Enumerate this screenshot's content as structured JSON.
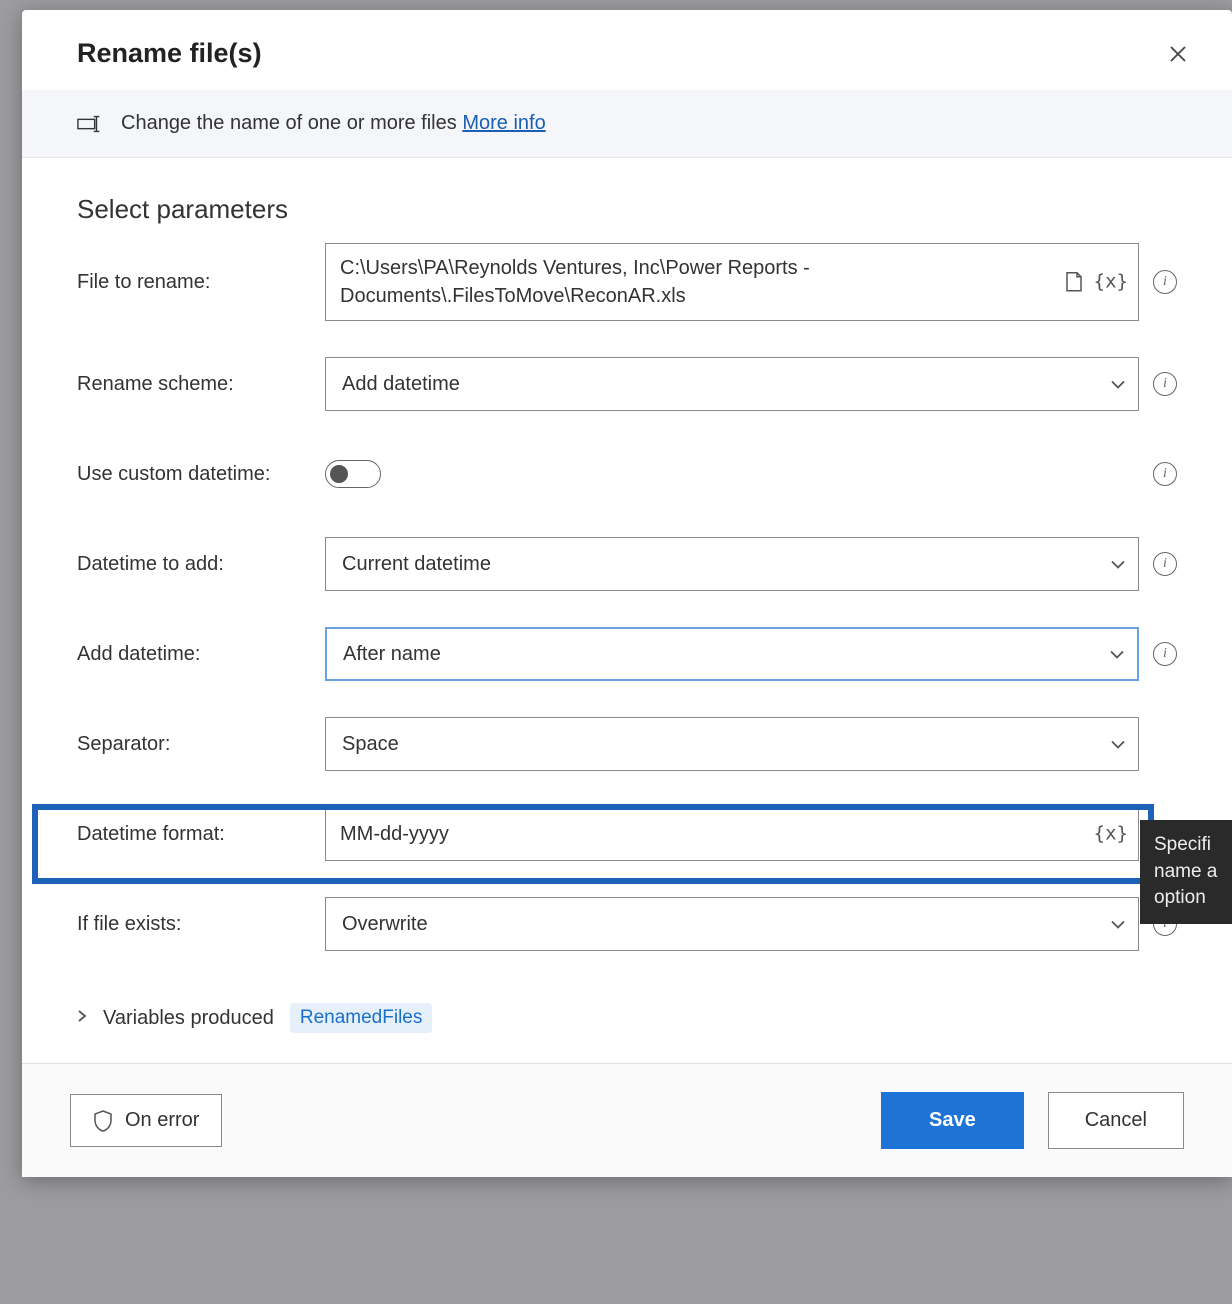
{
  "dialog": {
    "title": "Rename file(s)",
    "infoText": "Change the name of one or more files",
    "moreInfo": "More info",
    "sectionTitle": "Select parameters"
  },
  "fields": {
    "fileToRename": {
      "label": "File to rename:",
      "value": "C:\\Users\\PA\\Reynolds Ventures, Inc\\Power Reports - Documents\\.FilesToMove\\ReconAR.xls"
    },
    "renameScheme": {
      "label": "Rename scheme:",
      "value": "Add datetime"
    },
    "useCustomDatetime": {
      "label": "Use custom datetime:"
    },
    "datetimeToAdd": {
      "label": "Datetime to add:",
      "value": "Current datetime"
    },
    "addDatetime": {
      "label": "Add datetime:",
      "value": "After name"
    },
    "separator": {
      "label": "Separator:",
      "value": "Space"
    },
    "datetimeFormat": {
      "label": "Datetime format:",
      "value": "MM-dd-yyyy"
    },
    "ifFileExists": {
      "label": "If file exists:",
      "value": "Overwrite"
    }
  },
  "variables": {
    "label": "Variables produced",
    "badge": "RenamedFiles"
  },
  "footer": {
    "onError": "On error",
    "save": "Save",
    "cancel": "Cancel"
  },
  "tooltip": "Specifi\nname a\noption",
  "varToken": "{x}"
}
